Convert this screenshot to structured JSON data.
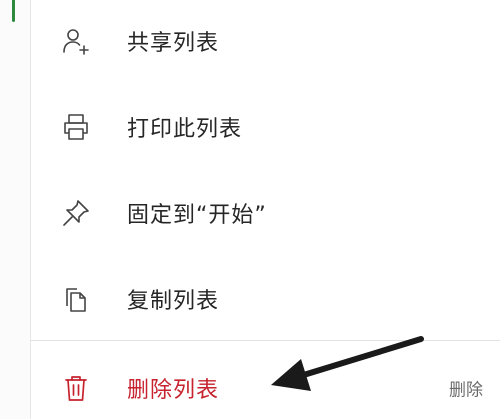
{
  "menu": {
    "items": [
      {
        "label": "共享列表",
        "icon": "share-person-icon"
      },
      {
        "label": "打印此列表",
        "icon": "printer-icon"
      },
      {
        "label": "固定到“开始”",
        "icon": "pin-icon"
      },
      {
        "label": "复制列表",
        "icon": "copy-icon"
      }
    ],
    "delete": {
      "label": "删除列表",
      "icon": "trash-icon",
      "shortcut": "删除"
    }
  },
  "colors": {
    "accent": "#2e8b3e",
    "danger": "#c6232f",
    "text": "#262626",
    "icon": "#444444",
    "annotation_arrow": "#1a1a1a"
  }
}
